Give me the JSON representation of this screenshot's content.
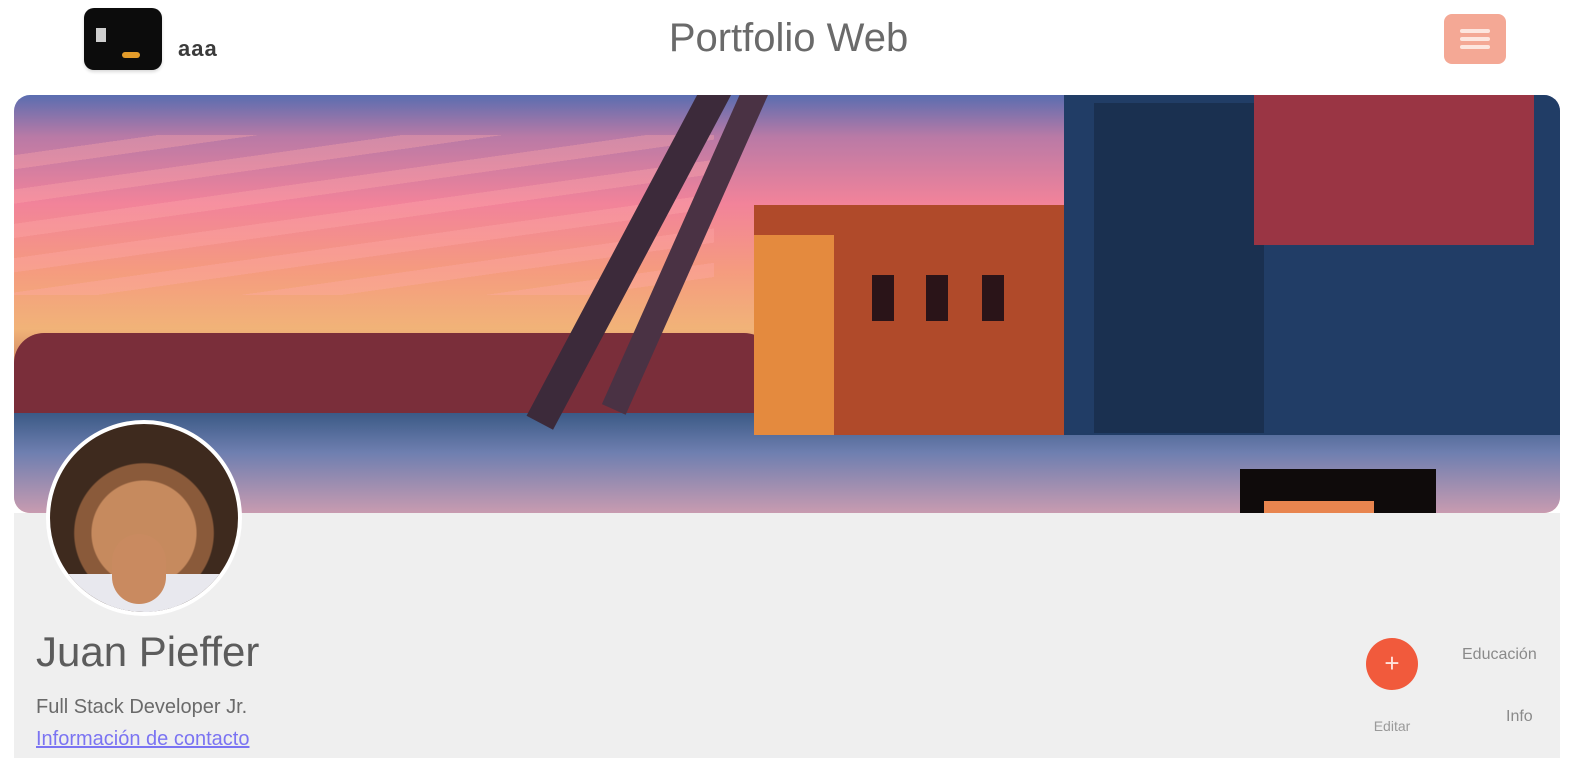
{
  "header": {
    "logo_text": "aaa",
    "title": "Portfolio Web",
    "menu_icon": "menu-icon"
  },
  "profile": {
    "name": "Juan Pieffer",
    "role": "Full Stack Developer Jr.",
    "link": "Información de contacto"
  },
  "actions": {
    "fab_icon": "plus-icon",
    "fab_label": "Editar",
    "side_label_1": "Educación",
    "side_label_2": "Info"
  },
  "colors": {
    "accent": "#f15a3c",
    "link": "#7b74f2",
    "content_bg": "#efefef"
  }
}
